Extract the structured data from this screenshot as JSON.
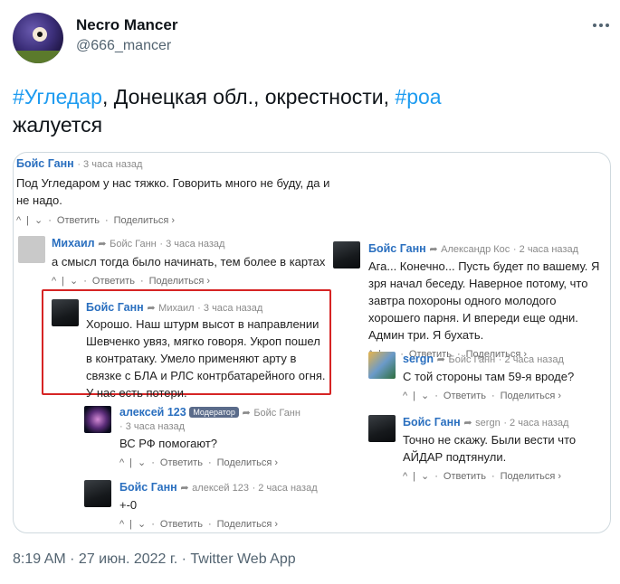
{
  "tweet": {
    "display_name": "Necro Mancer",
    "handle": "@666_mancer",
    "text_parts": {
      "hashtag1": "#Угледар",
      "middle": ", Донецкая обл., окрестности, ",
      "hashtag2": "#роа",
      "end": "жалуется"
    },
    "footer": "8:19 AM · 27 июн. 2022 г. · Twitter Web App"
  },
  "comments": {
    "c1": {
      "user": "Бойс Ганн",
      "time": "· 3 часа назад",
      "text": "Под Угледаром у нас тяжко. Говорить много не буду, да и не надо.",
      "reply": "Ответить",
      "share": "Поделиться ›"
    },
    "c2": {
      "user": "Михаил",
      "reply_to": "Бойс Ганн",
      "time": "· 3 часа назад",
      "text": "а смысл тогда было начинать, тем более в картах",
      "reply": "Ответить",
      "share": "Поделиться ›"
    },
    "c3": {
      "user": "Бойс Ганн",
      "reply_to": "Михаил",
      "time": "· 3 часа назад",
      "text": "Хорошо. Наш штурм высот в направлении Шевченко увяз, мягко говоря. Укроп пошел в контратаку. Умело применяют арту в связке с БЛА и РЛС контрбатарейного огня. У нас есть потери."
    },
    "c4": {
      "user": "алексей 123",
      "badge": "Модератор",
      "reply_to": "Бойс Ганн",
      "time": "· 3 часа назад",
      "text": "ВС РФ помогают?",
      "reply": "Ответить",
      "share": "Поделиться ›"
    },
    "c5": {
      "user": "Бойс Ганн",
      "reply_to": "алексей 123",
      "time": "· 2 часа назад",
      "text": "+-0",
      "reply": "Ответить",
      "share": "Поделиться ›"
    },
    "c6": {
      "user": "Бойс Ганн",
      "reply_to": "Александр Кос",
      "time": "· 2 часа назад",
      "text": "Ага... Конечно... Пусть будет по вашему. Я зря начал беседу. Наверное потому, что завтра похороны одного молодого хорошего парня. И впереди еще одни. Админ три. Я бухать.",
      "reply": "Ответить",
      "share": "Поделиться ›"
    },
    "c7": {
      "user": "sergn",
      "reply_to": "Бойс Ганн",
      "time": "· 2 часа назад",
      "text": "С той стороны там 59-я вроде?",
      "reply": "Ответить",
      "share": "Поделиться ›"
    },
    "c8": {
      "user": "Бойс Ганн",
      "reply_to": "sergn",
      "time": "· 2 часа назад",
      "text": "Точно не скажу. Были вести что АЙДАР подтянули.",
      "reply": "Ответить",
      "share": "Поделиться ›"
    }
  },
  "icons": {
    "reply_arrow": "➦",
    "up": "^",
    "down": "⌄",
    "sep": "|",
    "dot": "·"
  }
}
